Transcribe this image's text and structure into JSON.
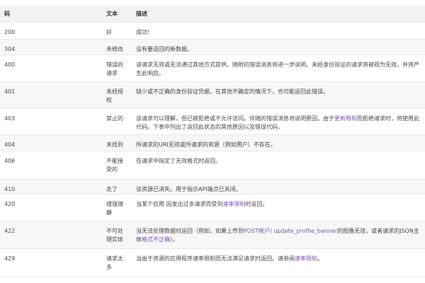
{
  "table": {
    "headers": [
      "码",
      "文本",
      "描述"
    ],
    "rows": [
      {
        "code": "200",
        "text": "好",
        "desc": [
          {
            "t": "成功!"
          }
        ]
      },
      {
        "code": "304",
        "text": "未修改",
        "desc": [
          {
            "t": "没有要返回的新数据。"
          }
        ]
      },
      {
        "code": "400",
        "text": "错误的请求",
        "desc": [
          {
            "t": "该请求无效或无法通过其他方式提供。随附的错误消息将进一步说明。未经身份验证的请求将被视为无效，并将产生此响应。"
          }
        ]
      },
      {
        "code": "401",
        "text": "未经授权",
        "desc": [
          {
            "t": "缺少或不正确的身份验证凭据。在其他不确定的情况下，也可能返回此错误。"
          }
        ]
      },
      {
        "code": "403",
        "text": "禁止的",
        "desc": [
          {
            "t": "该请求可以理解，但已被拒绝或不允许访问。伴随的错误消息将说明原因。由于"
          },
          {
            "t": "更新限制",
            "link": true
          },
          {
            "t": "而拒绝请求时，将使用此代码。下表中列出了返回此状态的其他原因以及错误代码。"
          }
        ]
      },
      {
        "code": "404",
        "text": "未找到",
        "desc": [
          {
            "t": "所请求的URI无效或所请求的资源（例如用户）不存在。"
          }
        ]
      },
      {
        "code": "406",
        "text": "不能接受的",
        "desc": [
          {
            "t": "在请求中指定了无效格式时返回。"
          }
        ]
      },
      {
        "code": "410",
        "text": "走了",
        "desc": [
          {
            "t": "该资源已消失。用于指示API端点已关闭。"
          }
        ]
      },
      {
        "code": "420",
        "text": "增强镇静",
        "desc": [
          {
            "t": "当某个应用 因发出过多请求而受到"
          },
          {
            "t": "速率限制",
            "link": true
          },
          {
            "t": "时返回。"
          }
        ]
      },
      {
        "code": "422",
        "text": "不可处理实体",
        "desc": [
          {
            "t": "当无法处理数据时返回（例如，如果上传到"
          },
          {
            "t": "POST帐户/ update_profile_banner",
            "link": true
          },
          {
            "t": "的图像无效，或者请求的JSON主体"
          },
          {
            "t": "格式不正确",
            "link": true
          },
          {
            "t": "）。"
          }
        ]
      },
      {
        "code": "429",
        "text": "请求太多",
        "desc": [
          {
            "t": "当由于资源的应用程序速率限制而无法满足请求时返回。请参阅"
          },
          {
            "t": "速率限制",
            "link": true
          },
          {
            "t": "。"
          }
        ]
      }
    ]
  },
  "colors": {
    "text": "#444444",
    "link": "#7952b3",
    "header_bg": "#f2f2f2",
    "stripe_bg": "#f7f7f7",
    "border": "#e8e8e8"
  }
}
